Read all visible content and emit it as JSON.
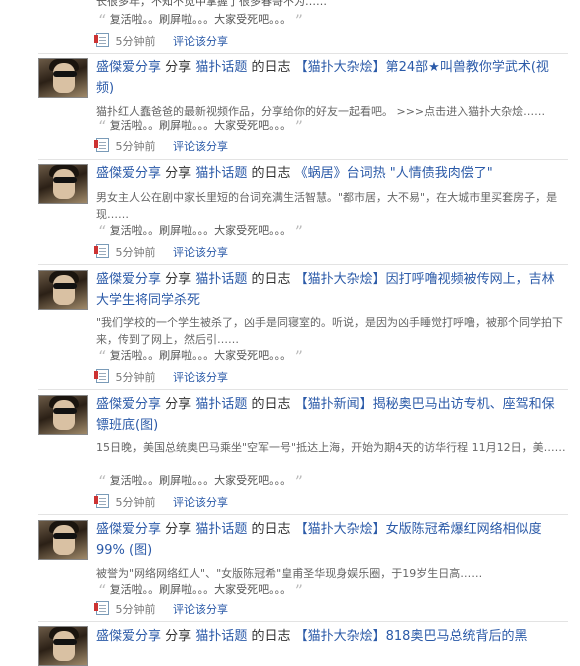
{
  "top_snippet": {
    "text": "长很多年，不知不觉中掌握了很多春哥不为……",
    "comment": "复活啦。。刷屏啦。。。大家受死吧。。。",
    "time": "5分钟前",
    "comment_link": "评论该分享"
  },
  "items": [
    {
      "user": "盛傑爱分享",
      "action": "分享",
      "source": "猫扑话题",
      "of": "的日志",
      "title": "【猫扑大杂烩】第24部★叫兽教你学武术(视频)",
      "desc": "猫扑红人蠢爸爸的最新视频作品，分享给你的好友一起看吧。 >>>点击进入猫扑大杂烩……",
      "comment": "复活啦。。刷屏啦。。。大家受死吧。。。",
      "time": "5分钟前",
      "comment_link": "评论该分享"
    },
    {
      "user": "盛傑爱分享",
      "action": "分享",
      "source": "猫扑话题",
      "of": "的日志",
      "title": "《蜗居》台词热 \"人情债我肉偿了\"",
      "desc": "男女主人公在剧中家长里短的台词充满生活智慧。\"都市居，大不易\"，在大城市里买套房子，是现……",
      "comment": "复活啦。。刷屏啦。。。大家受死吧。。。",
      "time": "5分钟前",
      "comment_link": "评论该分享"
    },
    {
      "user": "盛傑爱分享",
      "action": "分享",
      "source": "猫扑话题",
      "of": "的日志",
      "title": "【猫扑大杂烩】因打呼噜视频被传网上，吉林大学生将同学杀死",
      "desc": "\"我们学校的一个学生被杀了，凶手是同寝室的。听说，是因为凶手睡觉打呼噜，被那个同学拍下来，传到了网上，然后引……",
      "comment": "复活啦。。刷屏啦。。。大家受死吧。。。",
      "time": "5分钟前",
      "comment_link": "评论该分享"
    },
    {
      "user": "盛傑爱分享",
      "action": "分享",
      "source": "猫扑话题",
      "of": "的日志",
      "title": "【猫扑新闻】揭秘奥巴马出访专机、座驾和保镖班底(图)",
      "desc": "15日晚，美国总统奥巴马乘坐\"空军一号\"抵达上海，开始为期4天的访华行程 11月12日，美……",
      "comment": "复活啦。。刷屏啦。。。大家受死吧。。。",
      "time": "5分钟前",
      "comment_link": "评论该分享"
    },
    {
      "user": "盛傑爱分享",
      "action": "分享",
      "source": "猫扑话题",
      "of": "的日志",
      "title": "【猫扑大杂烩】女版陈冠希爆红网络相似度99% (图)",
      "desc": "被誉为\"网络网络红人\"、\"女版陈冠希\"皇甫圣华现身娱乐圈，于19岁生日高……",
      "comment": "复活啦。。刷屏啦。。。大家受死吧。。。",
      "time": "5分钟前",
      "comment_link": "评论该分享"
    },
    {
      "user": "盛傑爱分享",
      "action": "分享",
      "source": "猫扑话题",
      "of": "的日志",
      "title": "【猫扑大杂烩】818奥巴马总统背后的黑"
    }
  ]
}
